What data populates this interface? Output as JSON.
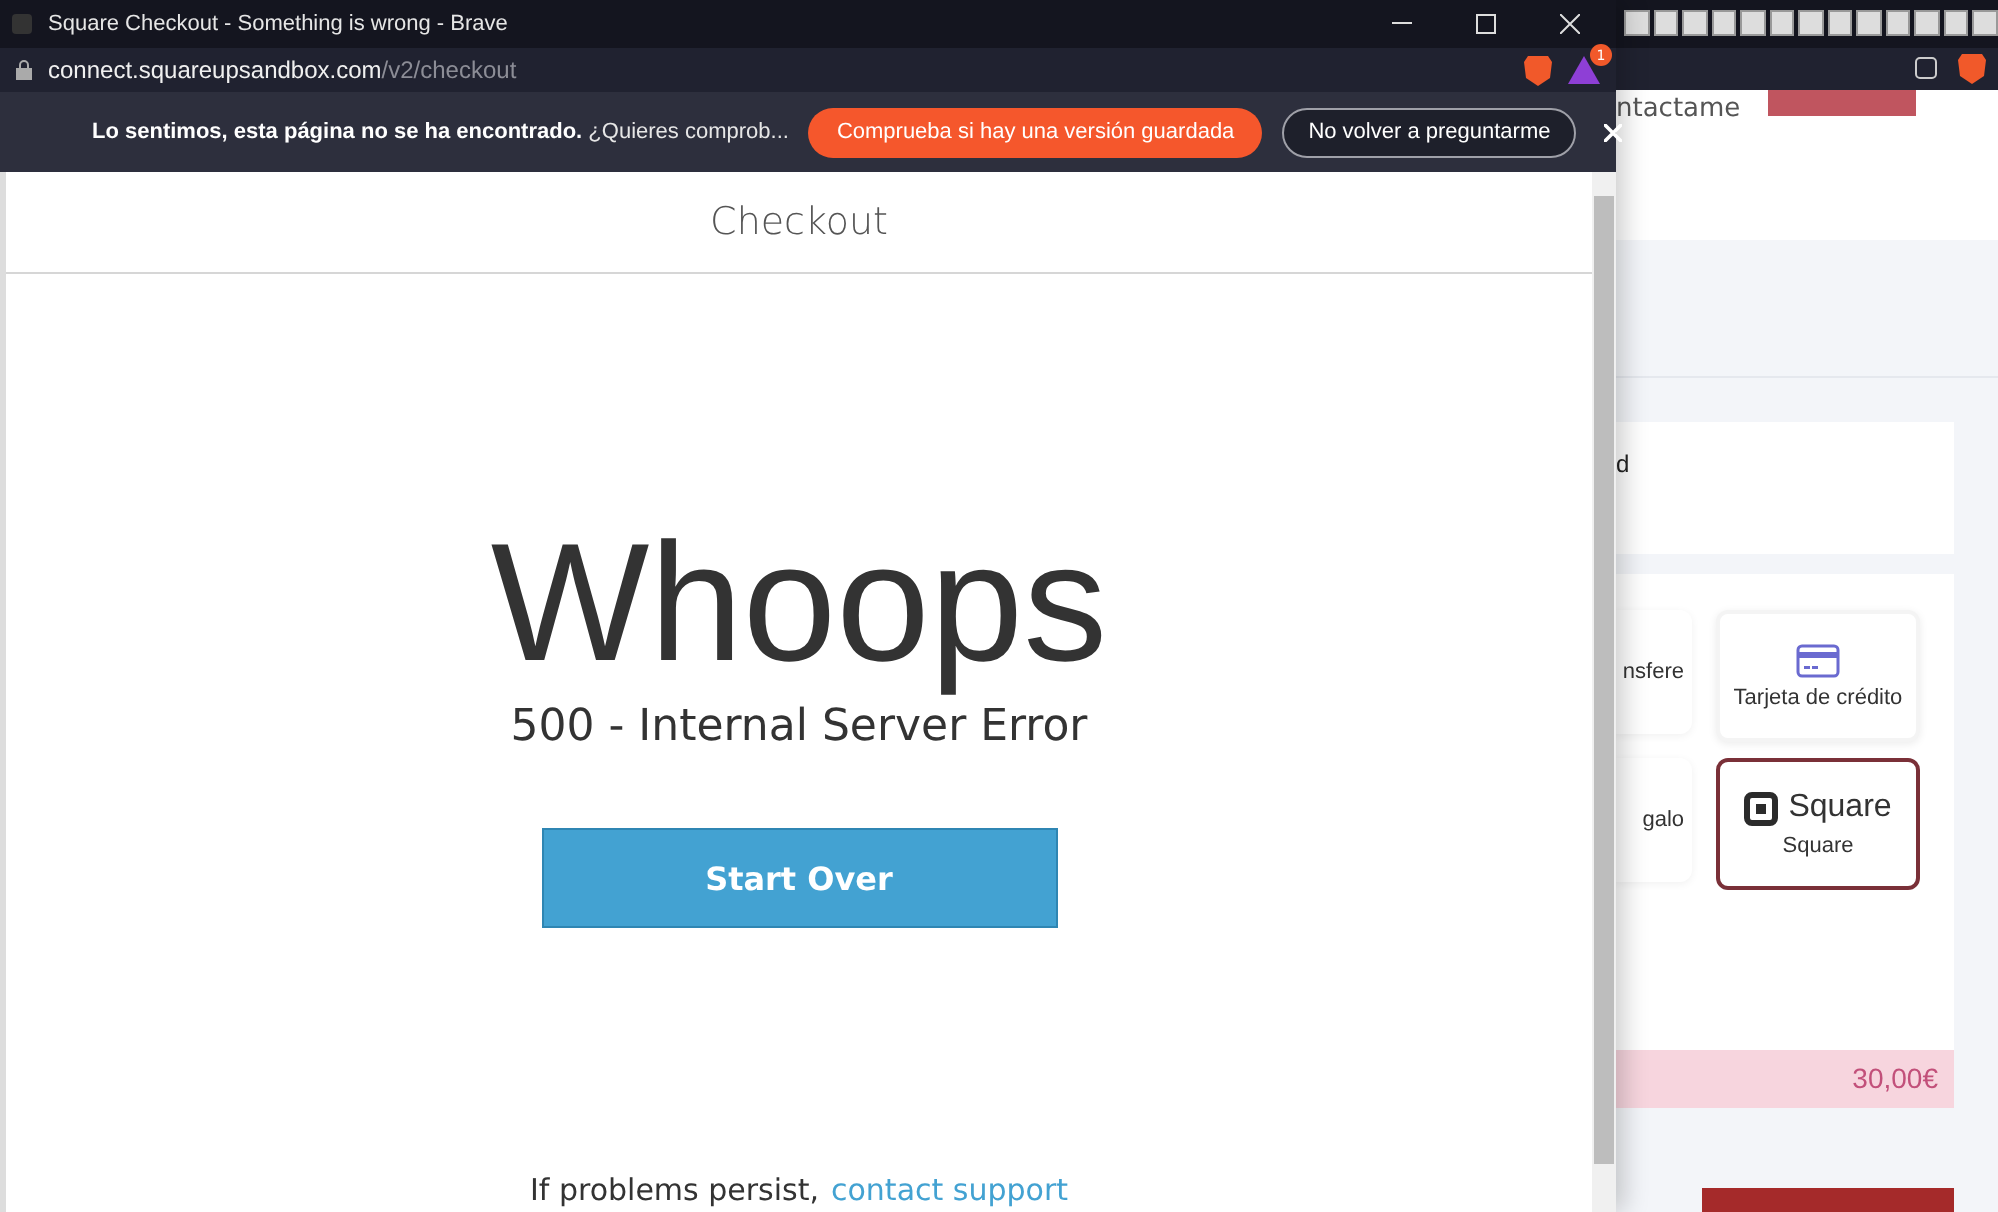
{
  "window": {
    "title": "Square Checkout - Something is wrong - Brave",
    "url_host": "connect.squareupsandbox.com",
    "url_path": "/v2/checkout",
    "notification_count": "1"
  },
  "infobar": {
    "message_bold": "Lo sentimos, esta página no se ha encontrado.",
    "message": "¿Quieres comprob...",
    "primary_button": "Comprueba si hay una versión guardada",
    "secondary_button": "No volver a preguntarme"
  },
  "page": {
    "header": "Checkout",
    "headline": "Whoops",
    "error": "500 - Internal Server Error",
    "button": "Start Over",
    "footer_text": "If problems persist,",
    "footer_link": "contact support"
  },
  "background_page": {
    "nav_link": "ntactame",
    "section_text": "d",
    "payment_options": [
      {
        "label": "nsfere",
        "kind": "partial"
      },
      {
        "label": "Tarjeta de crédito",
        "kind": "card",
        "selected": false
      },
      {
        "label": "galo",
        "kind": "partial"
      },
      {
        "label": "Square",
        "kind": "square",
        "logo_text": "Square",
        "selected": true
      }
    ],
    "total": "30,00€"
  }
}
